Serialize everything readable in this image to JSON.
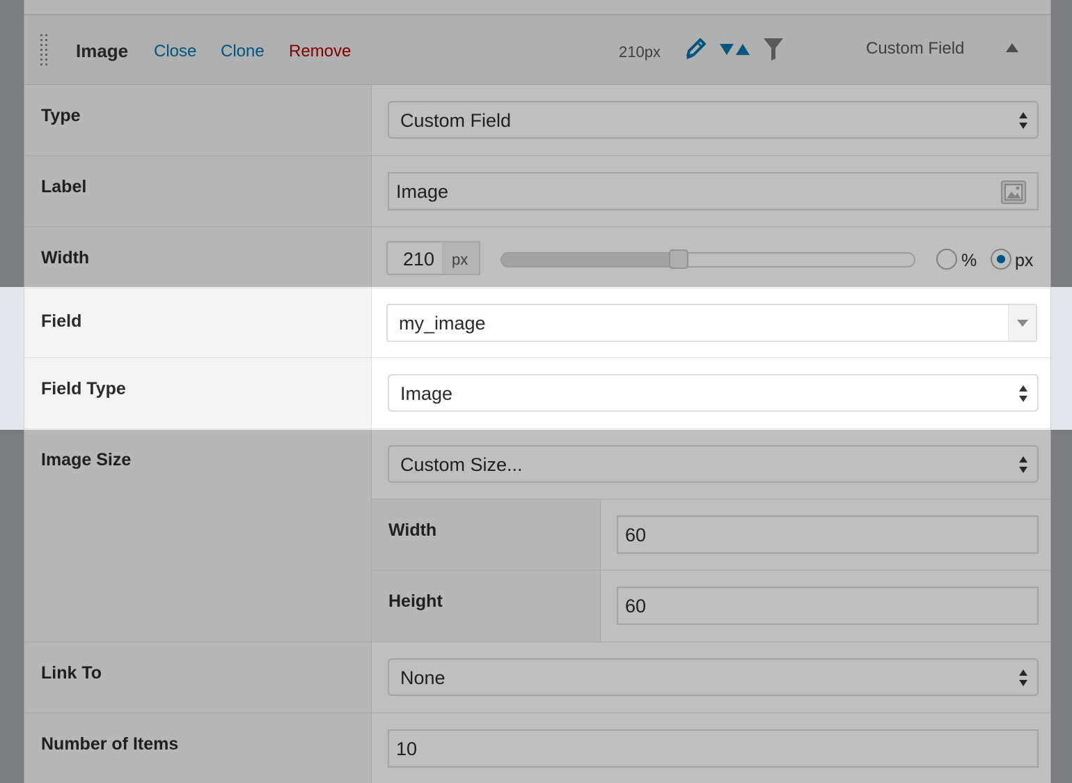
{
  "header": {
    "title": "Image",
    "close_label": "Close",
    "clone_label": "Clone",
    "remove_label": "Remove",
    "width_display": "210px",
    "column_type": "Custom Field"
  },
  "rows": {
    "type": {
      "label": "Type",
      "value": "Custom Field"
    },
    "label": {
      "label": "Label",
      "value": "Image"
    },
    "width": {
      "label": "Width",
      "value": "210",
      "unit": "px",
      "slider_fraction": 0.43,
      "unit_options": [
        "%",
        "px"
      ],
      "selected_unit": "px"
    },
    "field": {
      "label": "Field",
      "value": "my_image"
    },
    "field_type": {
      "label": "Field Type",
      "value": "Image"
    },
    "image_size": {
      "label": "Image Size",
      "value": "Custom Size...",
      "width_label": "Width",
      "width_value": "60",
      "height_label": "Height",
      "height_value": "60"
    },
    "link_to": {
      "label": "Link To",
      "value": "None"
    },
    "number_of_items": {
      "label": "Number of Items",
      "value": "10"
    }
  },
  "colors": {
    "link": "#0073aa",
    "remove": "#aa0000",
    "accent": "#0073aa"
  }
}
